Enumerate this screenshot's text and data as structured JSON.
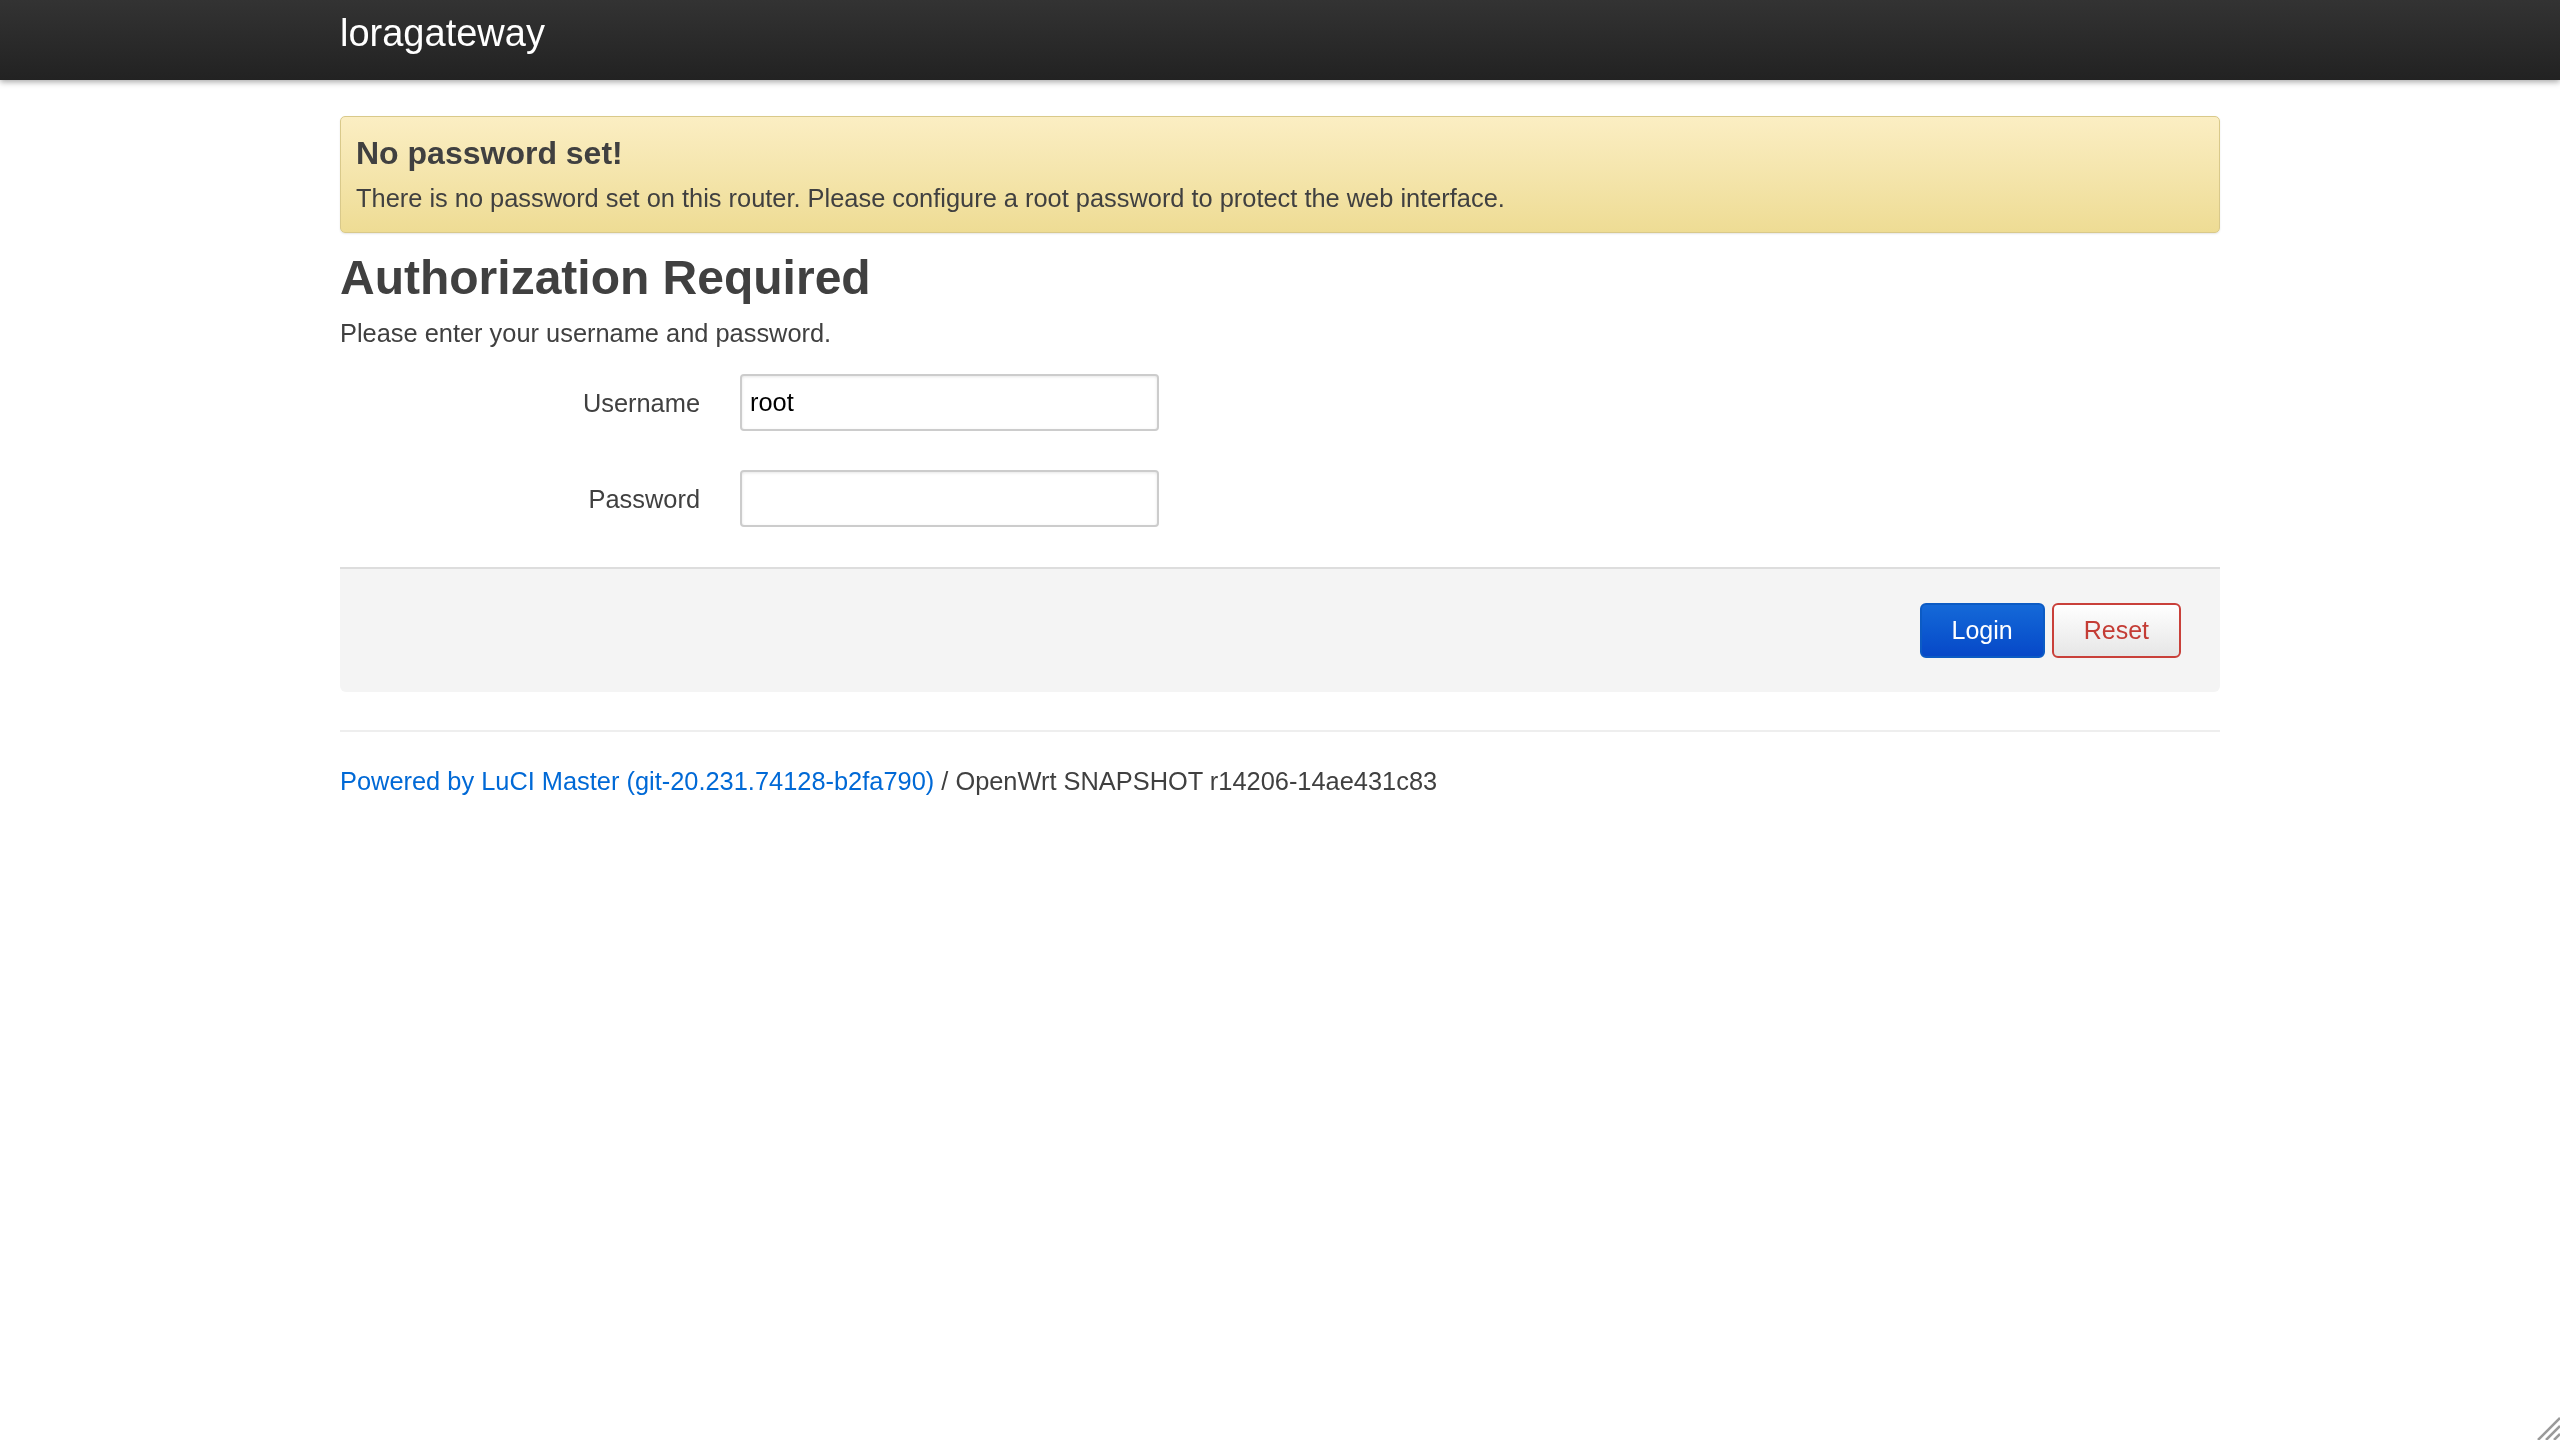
{
  "header": {
    "title": "loragateway"
  },
  "alert": {
    "title": "No password set!",
    "message": "There is no password set on this router. Please configure a root password to protect the web interface."
  },
  "page": {
    "heading": "Authorization Required",
    "description": "Please enter your username and password."
  },
  "form": {
    "fields": [
      {
        "label": "Username",
        "value": "root"
      },
      {
        "label": "Password"
      }
    ]
  },
  "actions": [
    {
      "label": "Login",
      "kind": "primary"
    },
    {
      "label": "Reset",
      "kind": "reset"
    }
  ],
  "footer": {
    "link": "Powered by LuCI Master (git-20.231.74128-b2fa790)",
    "text": "/ OpenWrt SNAPSHOT r14206-14ae431c83"
  }
}
